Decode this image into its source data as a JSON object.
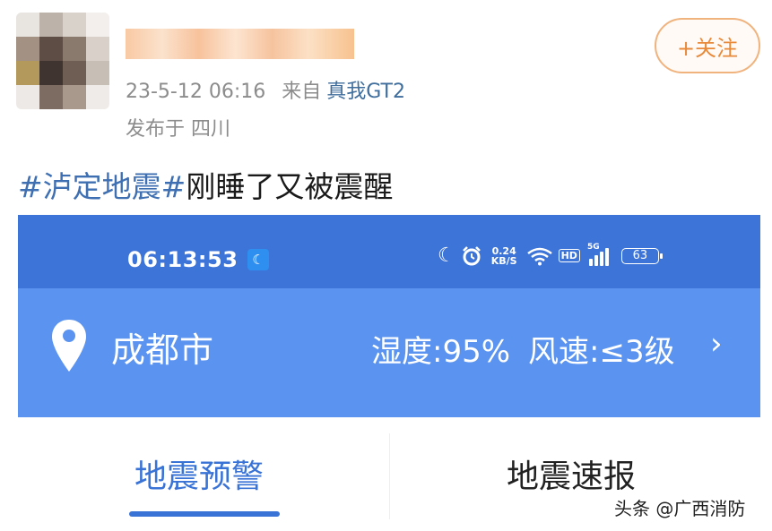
{
  "post": {
    "date": "23-5-12 06:16",
    "source_prefix": "来自",
    "device": "真我GT2",
    "location": "发布于 四川",
    "follow_label": "+关注",
    "topic": "#泸定地震#",
    "text": "刚睡了又被震醒"
  },
  "screenshot": {
    "status_bar": {
      "time": "06:13:53",
      "net_speed_value": "0.24",
      "net_speed_unit": "KB/S",
      "hd_label": "HD",
      "network_label": "5G",
      "battery": "63",
      "icons": [
        "moon-icon",
        "alarm-icon",
        "wifi-icon",
        "signal-icon",
        "battery-icon"
      ]
    },
    "city": "成都市",
    "humidity": "湿度:95%",
    "wind": "风速:≤3级",
    "chevron": "›",
    "tabs": [
      {
        "label": "地震预警",
        "active": true
      },
      {
        "label": "地震速报",
        "active": false
      }
    ]
  },
  "watermark": "头条 @广西消防",
  "colors": {
    "accent_orange": "#e8893a",
    "link_blue": "#3f6d9c",
    "topic_blue": "#3e6fb2",
    "status_bar_blue": "#3d74d8",
    "banner_blue": "#5b93f0",
    "tab_active_blue": "#3a73d6"
  }
}
